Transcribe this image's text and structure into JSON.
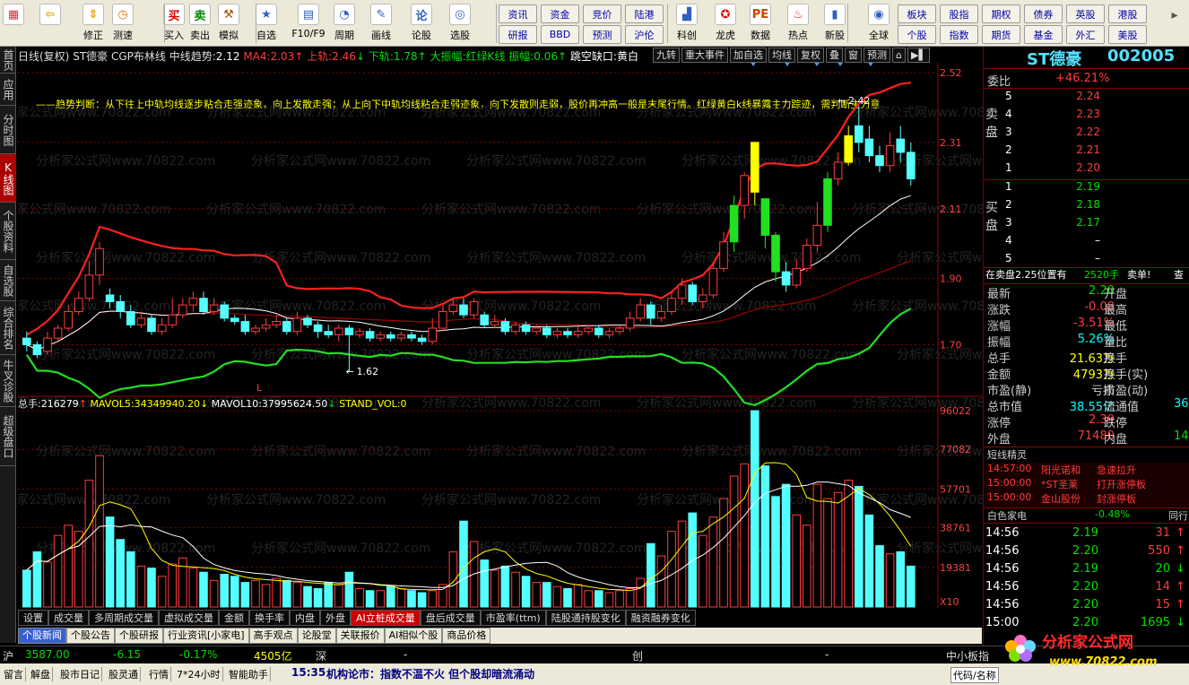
{
  "toolbar": {
    "buttons": [
      {
        "label": "",
        "icon": "layout-icon"
      },
      {
        "label": "",
        "icon": "back-arrow-icon"
      },
      {
        "label": "修正",
        "icon": "up-down-arrow-icon"
      },
      {
        "label": "测速",
        "icon": "clock-icon"
      },
      {
        "label": "买入",
        "icon": "buy-icon",
        "text": "买"
      },
      {
        "label": "卖出",
        "icon": "sell-icon",
        "text": "卖"
      },
      {
        "label": "模拟",
        "icon": "hammer-icon"
      },
      {
        "label": "自选",
        "icon": "star-folder-icon"
      },
      {
        "label": "F10/F9",
        "icon": "f10-icon"
      },
      {
        "label": "周期",
        "icon": "period-icon"
      },
      {
        "label": "画线",
        "icon": "pen-icon"
      },
      {
        "label": "论股",
        "icon": "discuss-icon"
      },
      {
        "label": "选股",
        "icon": "select-stock-icon"
      }
    ],
    "grid_left": [
      [
        "资讯",
        "资金",
        "竞价",
        "陆港"
      ],
      [
        "研报",
        "BBD",
        "预测",
        "沪伦"
      ]
    ],
    "buttons2": [
      {
        "label": "科创",
        "icon": "chart-icon"
      },
      {
        "label": "龙虎",
        "icon": "dragon-icon"
      },
      {
        "label": "数据",
        "icon": "pe-icon",
        "text": "PE"
      },
      {
        "label": "热点",
        "icon": "hot-icon"
      },
      {
        "label": "新股",
        "icon": "new-stock-icon"
      },
      {
        "label": "全球",
        "icon": "globe-icon"
      }
    ],
    "grid_right": [
      [
        "板块",
        "股指",
        "期权",
        "债券",
        "英股",
        "港股"
      ],
      [
        "个股",
        "指数",
        "期货",
        "基金",
        "外汇",
        "美股"
      ]
    ]
  },
  "left_tabs": [
    "首页",
    "应用",
    "分时图",
    "K线图",
    "个股资料",
    "自选股",
    "综合排名",
    "牛叉诊股",
    "超级盘口"
  ],
  "chart_header": {
    "period": "日线(复权)",
    "name": "ST德豪",
    "indicator": "CGP布林线",
    "mid_label": "中线趋势:",
    "mid_value": "2.12",
    "ma4_label": "MA4:",
    "ma4_value": "2.03",
    "upper_label": "上轨:",
    "upper_value": "2.46",
    "lower_label": "下轨:",
    "lower_value": "1.78",
    "amp_label": "大振幅:",
    "amp_value": "红绿K线",
    "amp2_label": "振幅:",
    "amp2_value": "0.06",
    "gap_label": "跳空缺口:",
    "gap_value": "黄白"
  },
  "chart_buttons": [
    "九转",
    "重大事件",
    "加自选",
    "均线",
    "复权",
    "叠",
    "窗",
    "预测"
  ],
  "trend_text": "——趋势判断：从下往上中轨均线逐步粘合走强迹象，向上发散走强；从上向下中轨均线粘合走弱迹象，向下发散则走弱，股价再冲高一般是末尾行情。红绿黄白k线暴露主力踪迹，需判断主力意",
  "price_axis": [
    "2.52",
    "2.31",
    "2.11",
    "1.90",
    "1.70"
  ],
  "annotations": {
    "high": "2.42",
    "low": "1.62",
    "marker": "L"
  },
  "volume_header": {
    "total_label": "总手:",
    "total_value": "216279",
    "mavol5_label": "MAVOL5:",
    "mavol5_value": "34349940.20",
    "mavol10_label": "MAVOL10:",
    "mavol10_value": "37995624.50",
    "stand_label": "STAND_VOL:",
    "stand_value": "0"
  },
  "volume_axis": [
    "96022",
    "77082",
    "57701",
    "38761",
    "19381"
  ],
  "volume_unit": "X10",
  "indicator_tabs": [
    "设置",
    "成交量",
    "多周期成交量",
    "虚拟成交量",
    "金额",
    "换手率",
    "内盘",
    "外盘",
    "AI立桩成交量",
    "盘后成交量",
    "市盈率(ttm)",
    "陆股通持股变化",
    "融资融券变化"
  ],
  "active_indicator": "AI立桩成交量",
  "info_tabs": [
    "个股新闻",
    "个股公告",
    "个股研报",
    "行业资讯[小家电]",
    "高手观点",
    "论股堂",
    "关联报价",
    "AI相似个股",
    "商品价格"
  ],
  "status1": {
    "sh_label": "沪",
    "sh_value": "3587.00",
    "sh_change": "-6.15",
    "sh_pct": "-0.17%",
    "sh_amount": "4505亿",
    "sz_label": "深",
    "sz_dash": "-",
    "cy_label": "创",
    "cy_dash": "-",
    "zxb_label": "中小板指",
    "zxb_dash": "-"
  },
  "status2": {
    "items": [
      "留言",
      "解盘",
      "股市日记",
      "股灵通",
      "行情",
      "7*24小时",
      "智能助手"
    ],
    "news_time": "15:35",
    "news_text": "机构论市：指数不温不火 但个股却暗流涌动",
    "right_label": "代码/名称"
  },
  "stock": {
    "name": "ST德豪",
    "code": "002005"
  },
  "weibi": {
    "label": "委比",
    "value": "+46.21%"
  },
  "sell_label": "卖盘",
  "buy_label": "买盘",
  "asks": [
    {
      "n": "5",
      "price": "2.24",
      "vol": ""
    },
    {
      "n": "4",
      "price": "2.23",
      "vol": ""
    },
    {
      "n": "3",
      "price": "2.22",
      "vol": ""
    },
    {
      "n": "2",
      "price": "2.21",
      "vol": ""
    },
    {
      "n": "1",
      "price": "2.20",
      "vol": ""
    }
  ],
  "bids": [
    {
      "n": "1",
      "price": "2.19",
      "vol": ""
    },
    {
      "n": "2",
      "price": "2.18",
      "vol": ""
    },
    {
      "n": "3",
      "price": "2.17",
      "vol": ""
    },
    {
      "n": "4",
      "price": "–",
      "vol": ""
    },
    {
      "n": "5",
      "price": "–",
      "vol": ""
    }
  ],
  "ask_note": {
    "text": "在卖盘2.25位置有",
    "vol": "2520手",
    "sell": "卖单!",
    "check": "查"
  },
  "quote": [
    {
      "l": "最新",
      "v": "2.20",
      "r": "开盘"
    },
    {
      "l": "涨跌",
      "v": "-0.08",
      "r": "最高"
    },
    {
      "l": "涨幅",
      "v": "-3.51%",
      "r": "最低"
    },
    {
      "l": "振幅",
      "v": "5.26%",
      "r": "量比"
    },
    {
      "l": "总手",
      "v": "21.63万",
      "r": "换手"
    },
    {
      "l": "金额",
      "v": "4793万",
      "r": "换手(实)"
    },
    {
      "l": "市盈(静)",
      "v": "亏损",
      "r": "市盈(动)"
    },
    {
      "l": "总市值",
      "v": "38.55亿",
      "r": "流通值",
      "r2": "36"
    },
    {
      "l": "涨停",
      "v": "2.39",
      "r": "跌停"
    },
    {
      "l": "外盘",
      "v": "71480",
      "r": "内盘",
      "r2": "14"
    }
  ],
  "sprite": {
    "title": "短线精灵",
    "items": [
      {
        "time": "14:57:00",
        "name": "阳光诺和",
        "evt": "急速拉升"
      },
      {
        "time": "15:00:00",
        "name": "*ST圣莱",
        "evt": "打开涨停板"
      },
      {
        "time": "15:00:00",
        "name": "金山股份",
        "evt": "封涨停板"
      }
    ]
  },
  "sector": {
    "name": "白色家电",
    "pct": "-0.48%",
    "link": "同行比"
  },
  "ticks": [
    {
      "t": "14:56",
      "p": "2.19",
      "v": "31",
      "d": "up"
    },
    {
      "t": "14:56",
      "p": "2.20",
      "v": "550",
      "d": "up"
    },
    {
      "t": "14:56",
      "p": "2.19",
      "v": "20",
      "d": "down"
    },
    {
      "t": "14:56",
      "p": "2.20",
      "v": "14",
      "d": "up"
    },
    {
      "t": "14:56",
      "p": "2.20",
      "v": "15",
      "d": "up"
    },
    {
      "t": "15:00",
      "p": "2.20",
      "v": "1695",
      "d": "down"
    }
  ],
  "logo": {
    "text": "分析家公式网",
    "url": "www.70822.com"
  },
  "watermark": "分析家公式网www.70822.com",
  "colors": {
    "red": "#ff3c3c",
    "green": "#00e000",
    "cyan": "#54ffff",
    "yellow": "#ffff00",
    "dark_red": "#800000"
  },
  "chart_data": {
    "type": "candlestick",
    "title": "ST德豪 日线(复权)",
    "ylim": [
      1.55,
      2.55
    ],
    "volume_ylim": [
      0,
      96022
    ],
    "candles": [
      [
        1.72,
        1.7,
        1.74,
        1.68
      ],
      [
        1.7,
        1.67,
        1.71,
        1.66
      ],
      [
        1.68,
        1.72,
        1.74,
        1.67
      ],
      [
        1.72,
        1.75,
        1.76,
        1.71
      ],
      [
        1.75,
        1.8,
        1.82,
        1.74
      ],
      [
        1.8,
        1.84,
        1.86,
        1.79
      ],
      [
        1.84,
        1.91,
        1.95,
        1.83
      ],
      [
        1.91,
        1.99,
        2.01,
        1.88
      ],
      [
        1.85,
        1.83,
        1.87,
        1.81
      ],
      [
        1.83,
        1.8,
        1.85,
        1.78
      ],
      [
        1.8,
        1.76,
        1.82,
        1.75
      ],
      [
        1.76,
        1.78,
        1.8,
        1.75
      ],
      [
        1.78,
        1.74,
        1.79,
        1.73
      ],
      [
        1.74,
        1.76,
        1.78,
        1.73
      ],
      [
        1.76,
        1.79,
        1.84,
        1.75
      ],
      [
        1.79,
        1.82,
        1.84,
        1.78
      ],
      [
        1.82,
        1.84,
        1.86,
        1.8
      ],
      [
        1.84,
        1.8,
        1.86,
        1.79
      ],
      [
        1.8,
        1.82,
        1.84,
        1.79
      ],
      [
        1.82,
        1.78,
        1.83,
        1.77
      ],
      [
        1.78,
        1.77,
        1.79,
        1.76
      ],
      [
        1.77,
        1.74,
        1.79,
        1.73
      ],
      [
        1.74,
        1.75,
        1.76,
        1.73
      ],
      [
        1.75,
        1.76,
        1.78,
        1.74
      ],
      [
        1.76,
        1.77,
        1.79,
        1.75
      ],
      [
        1.77,
        1.74,
        1.78,
        1.73
      ],
      [
        1.74,
        1.78,
        1.8,
        1.73
      ],
      [
        1.78,
        1.76,
        1.79,
        1.75
      ],
      [
        1.76,
        1.74,
        1.77,
        1.72
      ],
      [
        1.74,
        1.73,
        1.76,
        1.72
      ],
      [
        1.73,
        1.75,
        1.76,
        1.71
      ],
      [
        1.75,
        1.73,
        1.76,
        1.62
      ],
      [
        1.73,
        1.74,
        1.75,
        1.72
      ],
      [
        1.74,
        1.72,
        1.75,
        1.71
      ],
      [
        1.72,
        1.73,
        1.74,
        1.71
      ],
      [
        1.73,
        1.72,
        1.74,
        1.71
      ],
      [
        1.72,
        1.73,
        1.74,
        1.71
      ],
      [
        1.73,
        1.72,
        1.74,
        1.71
      ],
      [
        1.72,
        1.71,
        1.73,
        1.7
      ],
      [
        1.71,
        1.75,
        1.78,
        1.7
      ],
      [
        1.75,
        1.8,
        1.82,
        1.74
      ],
      [
        1.8,
        1.82,
        1.84,
        1.79
      ],
      [
        1.82,
        1.79,
        1.84,
        1.78
      ],
      [
        1.79,
        1.83,
        1.84,
        1.78
      ],
      [
        1.79,
        1.76,
        1.8,
        1.75
      ],
      [
        1.76,
        1.77,
        1.79,
        1.75
      ],
      [
        1.77,
        1.74,
        1.78,
        1.73
      ],
      [
        1.74,
        1.76,
        1.77,
        1.73
      ],
      [
        1.76,
        1.74,
        1.77,
        1.73
      ],
      [
        1.74,
        1.75,
        1.76,
        1.73
      ],
      [
        1.75,
        1.73,
        1.76,
        1.72
      ],
      [
        1.73,
        1.74,
        1.75,
        1.72
      ],
      [
        1.74,
        1.73,
        1.75,
        1.72
      ],
      [
        1.73,
        1.74,
        1.76,
        1.72
      ],
      [
        1.74,
        1.75,
        1.76,
        1.73
      ],
      [
        1.75,
        1.73,
        1.76,
        1.72
      ],
      [
        1.73,
        1.74,
        1.75,
        1.72
      ],
      [
        1.74,
        1.75,
        1.76,
        1.73
      ],
      [
        1.75,
        1.78,
        1.8,
        1.74
      ],
      [
        1.78,
        1.82,
        1.84,
        1.77
      ],
      [
        1.82,
        1.78,
        1.83,
        1.76
      ],
      [
        1.78,
        1.8,
        1.82,
        1.77
      ],
      [
        1.8,
        1.84,
        1.86,
        1.79
      ],
      [
        1.84,
        1.88,
        1.9,
        1.82
      ],
      [
        1.88,
        1.83,
        1.89,
        1.82
      ],
      [
        1.83,
        1.85,
        1.87,
        1.81
      ],
      [
        1.85,
        1.93,
        1.95,
        1.84
      ],
      [
        1.93,
        2.01,
        2.04,
        1.92
      ],
      [
        2.01,
        2.12,
        2.15,
        1.98
      ],
      [
        2.12,
        2.21,
        2.22,
        2.08
      ],
      [
        2.31,
        2.16,
        2.31,
        2.12
      ],
      [
        2.14,
        2.03,
        2.14,
        1.99
      ],
      [
        2.03,
        1.92,
        2.04,
        1.89
      ],
      [
        1.92,
        1.88,
        1.95,
        1.86
      ],
      [
        1.88,
        1.93,
        1.96,
        1.87
      ],
      [
        1.93,
        2.0,
        2.02,
        1.92
      ],
      [
        2.0,
        2.06,
        2.13,
        1.98
      ],
      [
        2.06,
        2.2,
        2.22,
        2.04
      ],
      [
        2.2,
        2.25,
        2.28,
        2.18
      ],
      [
        2.25,
        2.33,
        2.36,
        2.24
      ],
      [
        2.36,
        2.31,
        2.42,
        2.28
      ],
      [
        2.32,
        2.27,
        2.36,
        2.25
      ],
      [
        2.27,
        2.24,
        2.3,
        2.22
      ],
      [
        2.24,
        2.3,
        2.34,
        2.22
      ],
      [
        2.32,
        2.28,
        2.36,
        2.25
      ],
      [
        2.28,
        2.2,
        2.31,
        2.18
      ]
    ],
    "volume": [
      18,
      27,
      22,
      35,
      40,
      37,
      62,
      74,
      44,
      33,
      27,
      20,
      19,
      15,
      21,
      24,
      19,
      17,
      13,
      16,
      15,
      12,
      13,
      11,
      14,
      13,
      12,
      10,
      9,
      12,
      11,
      17,
      9,
      8,
      8,
      10,
      9,
      8,
      7,
      8,
      11,
      27,
      42,
      32,
      23,
      18,
      20,
      17,
      15,
      12,
      12,
      10,
      9,
      11,
      8,
      8,
      7,
      8,
      9,
      14,
      31,
      25,
      37,
      42,
      46,
      35,
      44,
      53,
      64,
      70,
      96,
      69,
      54,
      60,
      45,
      40,
      60,
      53,
      56,
      62,
      59,
      45,
      30,
      26,
      27,
      20
    ]
  }
}
